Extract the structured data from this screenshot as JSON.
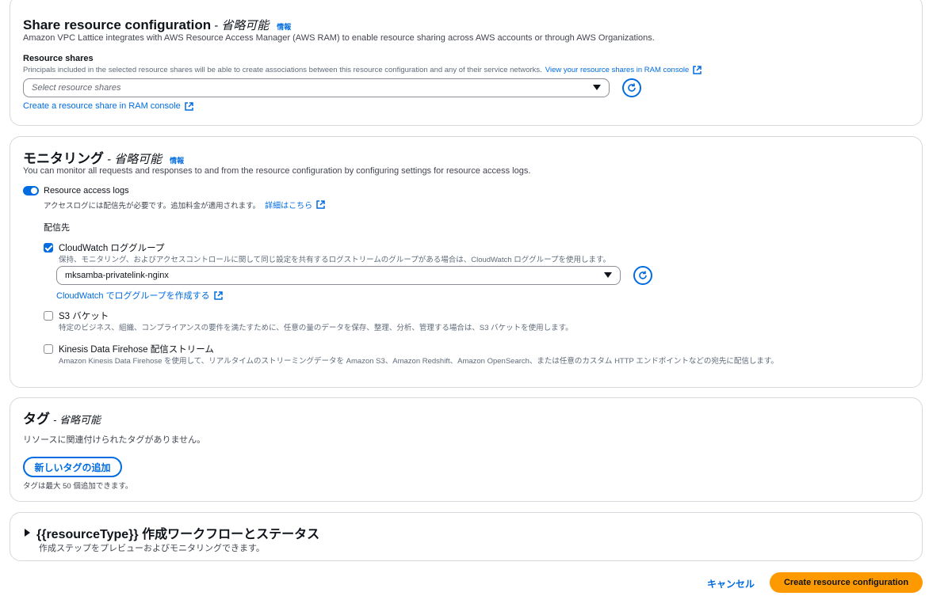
{
  "share": {
    "title": "Share resource configuration",
    "optional": "- 省略可能",
    "info": "情報",
    "description": "Amazon VPC Lattice integrates with AWS Resource Access Manager (AWS RAM) to enable resource sharing across AWS accounts or through AWS Organizations.",
    "field_label": "Resource shares",
    "field_help": "Principals included in the selected resource shares will be able to create associations between this resource configuration and any of their service networks.",
    "help_link": "View your resource shares in RAM console",
    "select_placeholder": "Select resource shares",
    "create_link": "Create a resource share in RAM console"
  },
  "monitoring": {
    "title": "モニタリング",
    "optional": "- 省略可能",
    "info": "情報",
    "description": "You can monitor all requests and responses to and from the resource configuration by configuring settings for resource access logs.",
    "toggle_label": "Resource access logs",
    "toggle_on": true,
    "toggle_help": "アクセスログには配信先が必要です。追加料金が適用されます。",
    "toggle_help_link": "詳細はこちら",
    "destination_label": "配信先",
    "options": [
      {
        "label": "CloudWatch ロググループ",
        "checked": true,
        "help": "保持、モニタリング、およびアクセスコントロールに関して同じ設定を共有するログストリームのグループがある場合は、CloudWatch ロググループを使用します。"
      },
      {
        "label": "S3 バケット",
        "checked": false,
        "help": "特定のビジネス、組織、コンプライアンスの要件を満たすために、任意の量のデータを保存、整理、分析、管理する場合は、S3 バケットを使用します。"
      },
      {
        "label": "Kinesis Data Firehose 配信ストリーム",
        "checked": false,
        "help": "Amazon Kinesis Data Firehose を使用して、リアルタイムのストリーミングデータを Amazon S3、Amazon Redshift、Amazon OpenSearch、または任意のカスタム HTTP エンドポイントなどの宛先に配信します。"
      }
    ],
    "log_group_value": "mksamba-privatelink-nginx",
    "log_group_create_link": "CloudWatch でロググループを作成する"
  },
  "tags": {
    "title": "タグ",
    "optional": "- 省略可能",
    "empty_text": "リソースに関連付けられたタグがありません。",
    "add_button": "新しいタグの追加",
    "limit_text": "タグは最大 50 個追加できます。"
  },
  "workflow": {
    "title": "{{resourceType}} 作成ワークフローとステータス",
    "description": "作成ステップをプレビューおよびモニタリングできます。",
    "expanded": false
  },
  "footer": {
    "cancel": "キャンセル",
    "submit": "Create resource configuration"
  },
  "colors": {
    "link": "#006ce0",
    "primary_button": "#ff9900",
    "border": "#d5d9de"
  }
}
